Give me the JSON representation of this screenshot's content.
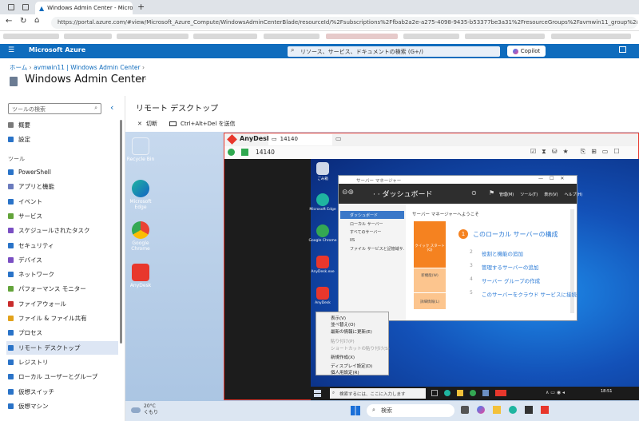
{
  "browser": {
    "tab_title": "Windows Admin Center - Micros",
    "url": "https://portal.azure.com/#view/Microsoft_Azure_Compute/WindowsAdminCenterBlade/resourceId/%2Fsubscriptions%2Ffbab2a2e-a275-4098-9435-b53377be3a31%2FresourceGroups%2Favmwin11_group%2Fproviders%2FMicro"
  },
  "azure": {
    "brand": "Microsoft Azure",
    "search_placeholder": "リソース、サービス、ドキュメントの検索 (G+/)",
    "copilot": "Copilot"
  },
  "breadcrumb": {
    "home": "ホーム",
    "resource": "avmwin11 | Windows Admin Center"
  },
  "page_title": "Windows Admin Center",
  "sidebar": {
    "search_placeholder": "ツールの検索",
    "top": [
      {
        "label": "概要",
        "color": "#7a7a7a"
      },
      {
        "label": "設定",
        "color": "#2a73c8"
      }
    ],
    "section": "ツール",
    "tools": [
      {
        "label": "PowerShell",
        "color": "#2a73c8"
      },
      {
        "label": "アプリと機能",
        "color": "#6b7bbd"
      },
      {
        "label": "イベント",
        "color": "#2a73c8"
      },
      {
        "label": "サービス",
        "color": "#63a43a"
      },
      {
        "label": "スケジュールされたタスク",
        "color": "#7a4fc3"
      },
      {
        "label": "セキュリティ",
        "color": "#2a73c8"
      },
      {
        "label": "デバイス",
        "color": "#7a4fc3"
      },
      {
        "label": "ネットワーク",
        "color": "#2a73c8"
      },
      {
        "label": "パフォーマンス モニター",
        "color": "#63a43a"
      },
      {
        "label": "ファイアウォール",
        "color": "#c92c2c"
      },
      {
        "label": "ファイル & ファイル共有",
        "color": "#e2a21b"
      },
      {
        "label": "プロセス",
        "color": "#2a73c8"
      },
      {
        "label": "リモート デスクトップ",
        "color": "#2a73c8",
        "selected": true
      },
      {
        "label": "レジストリ",
        "color": "#2a73c8"
      },
      {
        "label": "ローカル ユーザーとグループ",
        "color": "#2a73c8"
      },
      {
        "label": "仮想スイッチ",
        "color": "#2a73c8"
      },
      {
        "label": "仮想マシン",
        "color": "#2a73c8"
      }
    ]
  },
  "panel": {
    "title": "リモート デスクトップ",
    "disconnect": "切断",
    "ctrl_alt_del": "Ctrl+Alt+Del を送信"
  },
  "remote_desktop": {
    "icons": [
      "Recycle Bin",
      "Microsoft Edge",
      "Google Chrome",
      "AnyDesk"
    ],
    "anydesk_title": "AnyDesk",
    "anydesk_tab_id": "14140",
    "anydesk_address": "14140",
    "weather_temp": "20°C",
    "weather_desc": "くもり",
    "taskbar_search": "検索",
    "accent_color": "#e8372c"
  },
  "inner_desktop": {
    "icons": [
      "ごみ箱",
      "Microsoft Edge",
      "Google Chrome",
      "AnyDesk.exe",
      "AnyDesk"
    ],
    "server_manager": {
      "window_title": "サーバー マネージャー",
      "dashboard": "ダッシュボード",
      "menu": [
        "管理(M)",
        "ツール(T)",
        "表示(V)",
        "ヘルプ(H)"
      ],
      "nav": [
        "ダッシュボード",
        "ローカル サーバー",
        "すべてのサーバー",
        "IIS",
        "ファイル サービスと記憶域サ..."
      ],
      "welcome": "サーバー マネージャーへようこそ",
      "configure": "このローカル サーバーの構成",
      "steps": [
        "役割と機能の追加",
        "管理するサーバーの追加",
        "サーバー グループの作成",
        "このサーバーをクラウド サービスに接続"
      ],
      "quick_start": "クイック スタート(Q)",
      "new_features": "新機能(W)",
      "learn_more": "詳細情報(L)"
    },
    "context_menu": [
      "表示(V)",
      "並べ替え(O)",
      "最新の情報に更新(E)",
      "貼り付け(P)",
      "ショートカットの貼り付け(S)",
      "新規作成(X)",
      "ディスプレイ設定(D)",
      "個人用設定(R)"
    ],
    "taskbar_search": "検索するには、ここに入力します",
    "clock": "18:51"
  }
}
